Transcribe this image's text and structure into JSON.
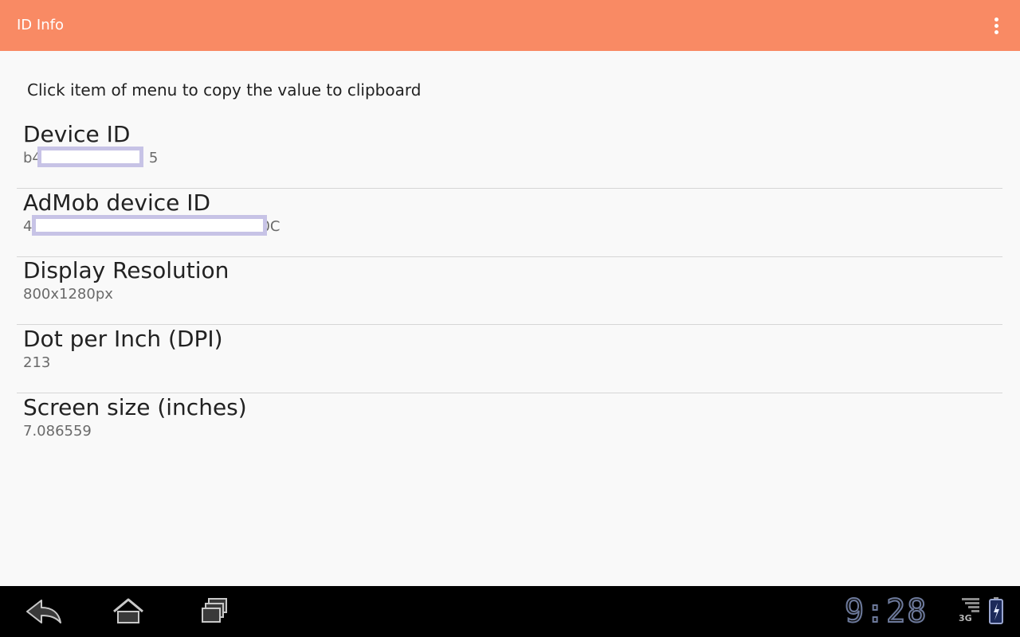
{
  "app_bar": {
    "title": "ID Info",
    "menu_icon": "overflow-menu-icon"
  },
  "hint": "Click item of menu to copy the value to clipboard",
  "items": [
    {
      "label": "Device ID",
      "value_prefix": "b4",
      "value_suffix": "5",
      "redacted": true
    },
    {
      "label": "AdMob device ID",
      "value_prefix": "4",
      "value_suffix": "0C",
      "redacted": true
    },
    {
      "label": "Display Resolution",
      "value": "800x1280px"
    },
    {
      "label": "Dot per Inch (DPI)",
      "value": "213"
    },
    {
      "label": "Screen size (inches)",
      "value": "7.086559"
    }
  ],
  "nav_bar": {
    "buttons": [
      "back-icon",
      "home-icon",
      "recent-apps-icon"
    ]
  },
  "status": {
    "clock": "9:28",
    "network": "3G"
  },
  "colors": {
    "accent": "#f98a64",
    "redaction": "#c7c3e6"
  }
}
